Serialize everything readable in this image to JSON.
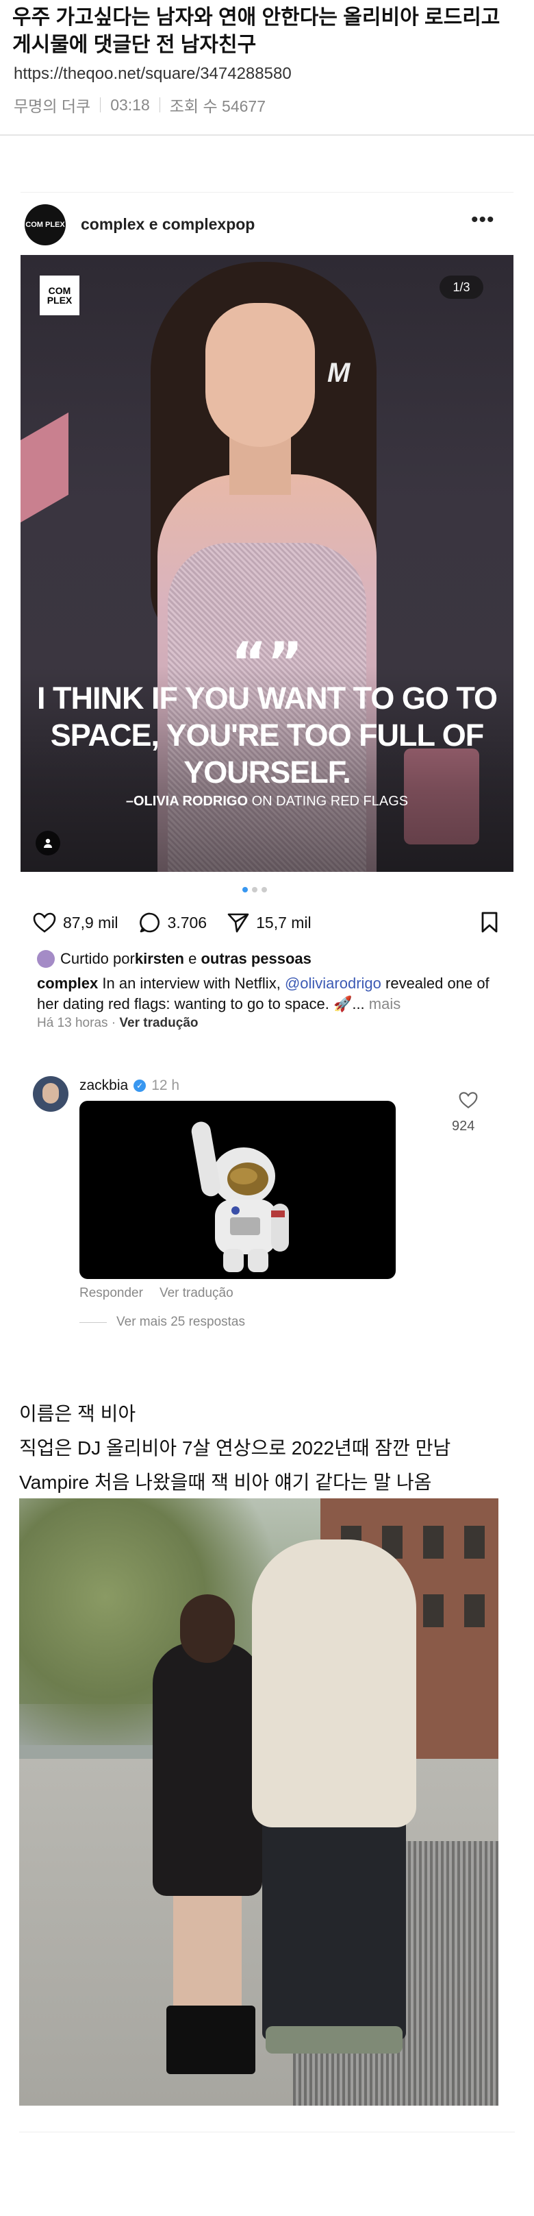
{
  "post": {
    "title": "우주 가고싶다는 남자와 연애 안한다는 올리비아 로드리고 게시물에 댓글단 전 남자친구",
    "url": "https://theqoo.net/square/3474288580",
    "author": "무명의 더쿠",
    "time": "03:18",
    "views": "조회 수 54677"
  },
  "instagram": {
    "username": "complex e complexpop",
    "avatar_text": "COM PLEX",
    "more_icon": "ellipsis-icon",
    "image": {
      "logo_text": "COM PLEX",
      "mtv_text": "M",
      "counter": "1/3",
      "quote_marks": "“”",
      "quote": "I THINK IF YOU WANT TO GO TO SPACE, YOU'RE TOO FULL OF YOURSELF.",
      "attribution_name": "–OLIVIA RODRIGO",
      "attribution_rest": " ON DATING RED FLAGS"
    },
    "likes": "87,9 mil",
    "comments": "3.706",
    "shares": "15,7 mil",
    "liked_by_prefix": "Curtido por ",
    "liked_by_user": "kirsten",
    "liked_by_mid": " e ",
    "liked_by_others": "outras pessoas",
    "caption_user": "complex",
    "caption_text_1": " In an interview with Netflix, ",
    "caption_mention": "@oliviarodrigo",
    "caption_text_2": " revealed one of her dating red flags: wanting to go to space. 🚀... ",
    "caption_more": "mais",
    "time_ago": "Há 13 horas",
    "translate": "Ver tradução"
  },
  "comment": {
    "username": "zackbia",
    "time": "12 h",
    "like_count": "924",
    "reply": "Responder",
    "translate": "Ver tradução",
    "see_more": "Ver mais 25 respostas"
  },
  "body": {
    "line1": "이름은 잭 비아",
    "line2": "직업은 DJ 올리비아 7살 연상으로 2022년때 잠깐 만남",
    "line3": "Vampire 처음 나왔을때 잭 비아 얘기 같다는 말 나옴"
  },
  "colors": {
    "accent_blue": "#3897f0",
    "mention_blue": "#3c5ab4"
  }
}
